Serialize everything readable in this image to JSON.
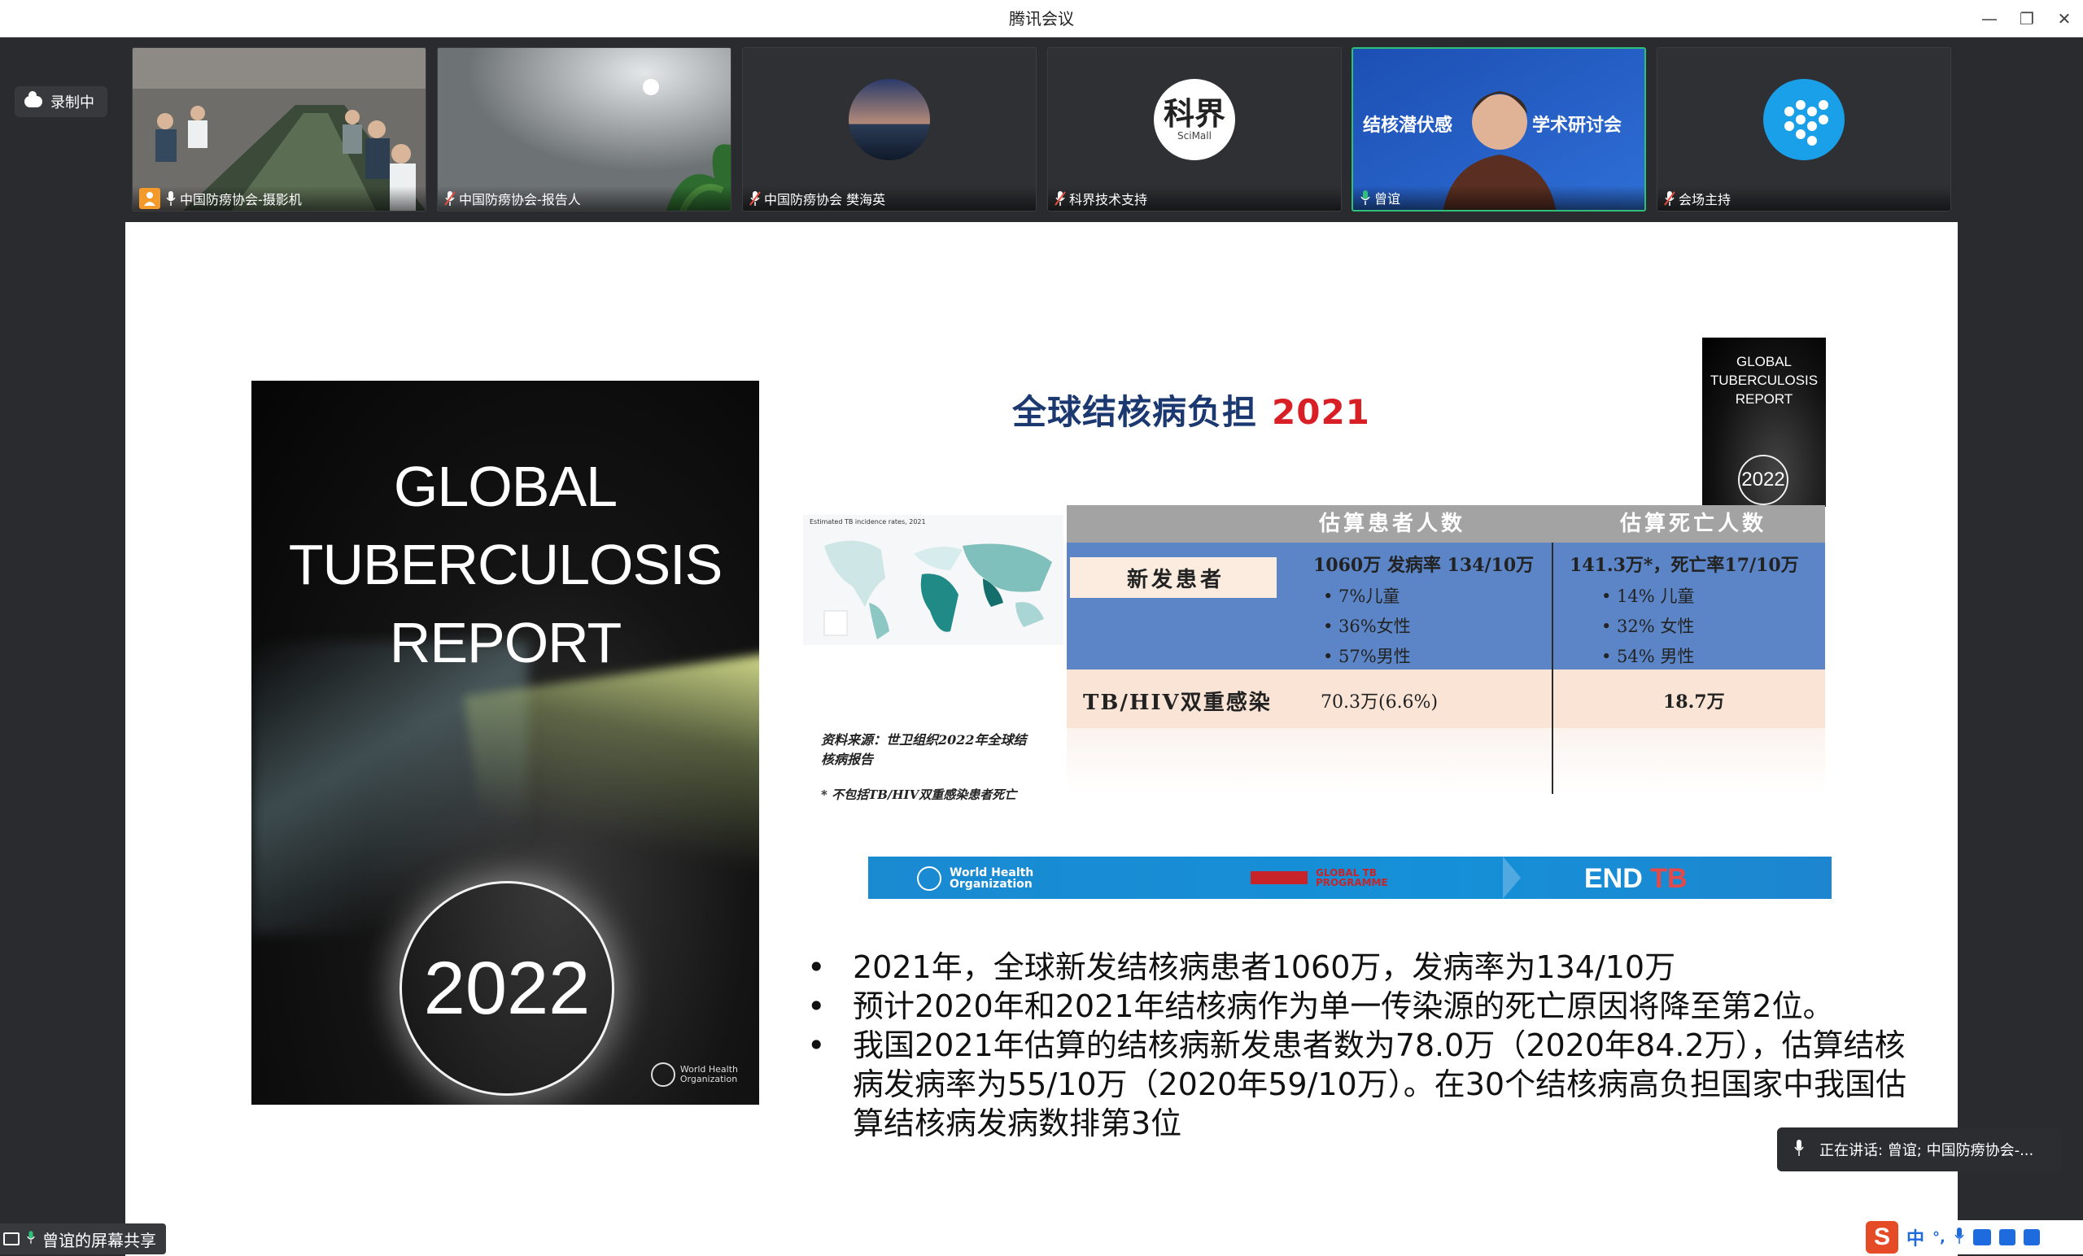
{
  "window": {
    "title": "腾讯会议",
    "minimize_glyph": "—",
    "restore_glyph": "❐",
    "close_glyph": "✕"
  },
  "recording": {
    "label": "录制中",
    "icon": "cloud-icon"
  },
  "participants": [
    {
      "name": "中国防痨协会-摄影机",
      "mic": "unmuted",
      "badge": "person-icon"
    },
    {
      "name": "中国防痨协会-报告人",
      "mic": "muted"
    },
    {
      "name": "中国防痨协会 樊海英",
      "mic": "muted"
    },
    {
      "name": "科界技术支持",
      "mic": "muted",
      "logo_text": "科界",
      "logo_sub": "SciMall"
    },
    {
      "name": "曾谊",
      "mic": "speaking",
      "bg_text_left": "结核潜伏感",
      "bg_text_right": "学术研讨会",
      "active": true
    },
    {
      "name": "会场主持",
      "mic": "muted"
    }
  ],
  "slide": {
    "cover": {
      "lines": [
        "GLOBAL",
        "TUBERCULOSIS",
        "REPORT"
      ],
      "year": "2022",
      "org": [
        "World Health",
        "Organization"
      ]
    },
    "heading": {
      "text": "全球结核病负担",
      "year": "2021"
    },
    "mini_cover": {
      "lines": [
        "GLOBAL",
        "TUBERCULOSIS",
        "REPORT"
      ],
      "year": "2022"
    },
    "map_caption": "Estimated TB incidence rates, 2021",
    "table": {
      "col_patients": "估算患者人数",
      "col_deaths": "估算死亡人数",
      "row_new": {
        "label": "新发患者",
        "patients_main": "1060万 发病率 134/10万",
        "patients_items": [
          "• 7%儿童",
          "• 36%女性",
          "• 57%男性"
        ],
        "deaths_main": "141.3万*，死亡率17/10万",
        "deaths_items": [
          "• 14% 儿童",
          "• 32% 女性",
          "• 54% 男性"
        ]
      },
      "row_hiv": {
        "label": "TB/HIV双重感染",
        "patients": "70.3万(6.6%)",
        "deaths": "18.7万"
      }
    },
    "source_note": [
      "资料来源：世卫组织2022年全球结",
      "核病报告"
    ],
    "exclusion_note": "* 不包括TB/HIV双重感染患者死亡",
    "banner": {
      "who": [
        "World Health",
        "Organization"
      ],
      "programme": [
        "GLOBAL TB",
        "PROGRAMME"
      ],
      "end": "END",
      "tb": "TB"
    },
    "bullets": [
      "2021年，全球新发结核病患者1060万，发病率为134/10万",
      "预计2020年和2021年结核病作为单一传染源的死亡原因将降至第2位。",
      "我国2021年估算的结核病新发患者数为78.0万（2020年84.2万），估算结核病发病率为55/10万（2020年59/10万）。在30个结核病高负担国家中我国估算结核病发病数排第3位"
    ]
  },
  "speaking_toast": "正在讲话: 曾谊; 中国防痨协会-...",
  "screen_share": "曾谊的屏幕共享",
  "ime": {
    "brand": "S",
    "mode": "中",
    "punct": "°,"
  }
}
